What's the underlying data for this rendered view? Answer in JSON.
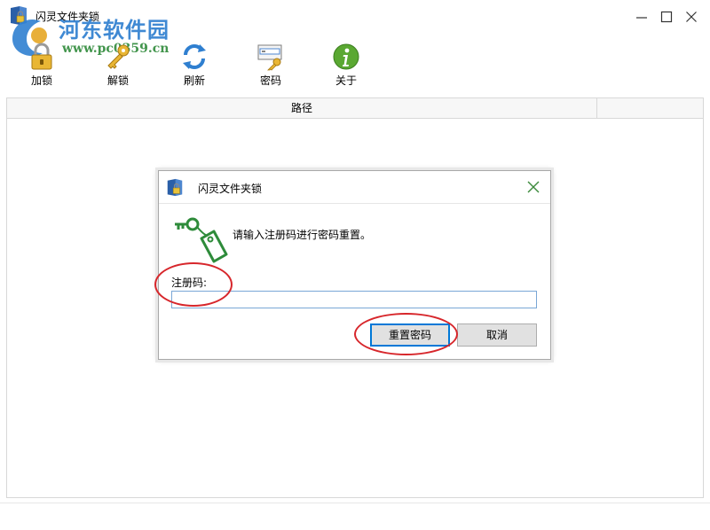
{
  "window": {
    "title": "闪灵文件夹锁"
  },
  "watermark": {
    "site_name": "河东软件园",
    "url": "www.pc0359.cn"
  },
  "toolbar": {
    "items": [
      {
        "label": "加锁",
        "icon": "lock-icon"
      },
      {
        "label": "解锁",
        "icon": "key-icon"
      },
      {
        "label": "刷新",
        "icon": "refresh-icon"
      },
      {
        "label": "密码",
        "icon": "password-icon"
      },
      {
        "label": "关于",
        "icon": "info-icon"
      }
    ]
  },
  "table": {
    "columns": [
      "路径"
    ]
  },
  "dialog": {
    "title": "闪灵文件夹锁",
    "message": "请输入注册码进行密码重置。",
    "reg_label": "注册码:",
    "reg_value": "",
    "reset_button": "重置密码",
    "cancel_button": "取消"
  },
  "colors": {
    "accent": "#0078d7",
    "highlight_circle": "#d7262b",
    "key_green": "#2e8b3a"
  }
}
